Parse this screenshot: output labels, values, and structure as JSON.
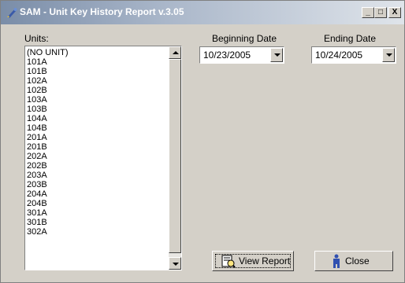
{
  "window": {
    "title": "SAM - Unit Key History Report v.3.05",
    "minimize_label": "_",
    "maximize_label": "□",
    "close_label": "X"
  },
  "units": {
    "label": "Units:",
    "items": [
      "(NO UNIT)",
      "101A",
      "101B",
      "102A",
      "102B",
      "103A",
      "103B",
      "104A",
      "104B",
      "201A",
      "201B",
      "202A",
      "202B",
      "203A",
      "203B",
      "204A",
      "204B",
      "301A",
      "301B",
      "302A"
    ]
  },
  "beginning_date": {
    "label": "Beginning Date",
    "value": "10/23/2005"
  },
  "ending_date": {
    "label": "Ending Date",
    "value": "10/24/2005"
  },
  "buttons": {
    "view_report": "View Report",
    "close": "Close"
  },
  "colors": {
    "face": "#d4d0c8",
    "title_start": "#7a8da8",
    "title_end": "#dfe4ea"
  }
}
